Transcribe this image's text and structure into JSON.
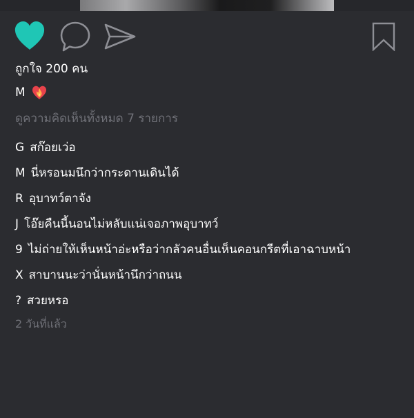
{
  "colors": {
    "background": "#2b2c30",
    "liked_heart": "#1fc6b5",
    "icon_outline": "#8e8f95",
    "muted_text": "#6f7077",
    "primary_text": "#ffffff"
  },
  "actions": {
    "like_icon": "heart-filled",
    "comment_icon": "speech-bubble",
    "share_icon": "paper-plane",
    "save_icon": "bookmark"
  },
  "post": {
    "likes_text": "ถูกใจ 200 คน",
    "caption": {
      "username": "M",
      "emoji_icon": "heart-on-fire"
    },
    "view_all_comments": "ดูความคิดเห็นทั้งหมด 7 รายการ",
    "comments": [
      {
        "user": "G",
        "text": "สก๊อยเว่อ"
      },
      {
        "user": "M",
        "text": "นี่หรอนมนึกว่ากระดานเดินได้"
      },
      {
        "user": "R",
        "text": "อุบาทว์ตาจัง"
      },
      {
        "user": "J",
        "text": "โอ๊ยคืนนี้นอนไม่หลับแน่เจอภาพอุบาทว์"
      },
      {
        "user": "9",
        "text": "ไม่ถ่ายให้เห็นหน้าอ่ะหรือว่ากลัวคนอื่นเห็นคอนกรีตที่เอาฉาบหน้า"
      },
      {
        "user": "X",
        "text": "สาบานนะว่านั่นหน้านึกว่าถนน"
      },
      {
        "user": "?",
        "text": "สวยหรอ"
      }
    ],
    "timestamp": "2 วันที่แล้ว"
  }
}
